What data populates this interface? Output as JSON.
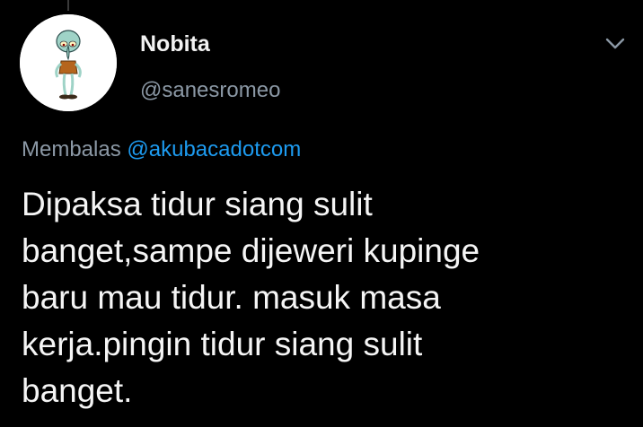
{
  "tweet": {
    "author": {
      "display_name": "Nobita",
      "handle": "@sanesromeo",
      "avatar_icon": "squidward-avatar"
    },
    "reply": {
      "prefix": "Membalas",
      "mention": "@akubacadotcom"
    },
    "text": "Dipaksa tidur siang sulit\nbanget,sampe dijeweri kupinge\nbaru mau tidur. masuk masa\nkerja.pingin tidur siang sulit\nbanget.",
    "menu_icon": "chevron-down-icon"
  },
  "colors": {
    "background": "#000000",
    "primary_text": "#f5f5f5",
    "secondary_text": "#8b98a5",
    "link": "#1d9bf0"
  }
}
